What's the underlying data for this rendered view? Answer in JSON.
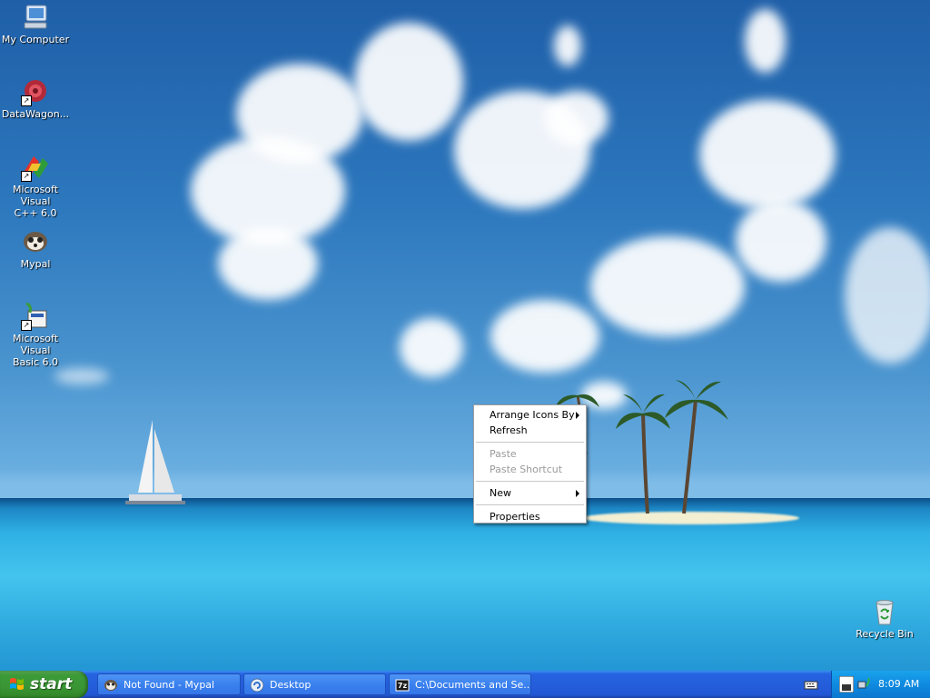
{
  "desktop_icons": [
    {
      "label": "My Computer",
      "icon": "my-computer-icon"
    },
    {
      "label": "DataWagon...",
      "icon": "datawagon-icon"
    },
    {
      "label_line1": "Microsoft Visual",
      "label_line2": "C++ 6.0",
      "icon": "visual-cpp-icon"
    },
    {
      "label": "Mypal",
      "icon": "mypal-icon"
    },
    {
      "label_line1": "Microsoft Visual",
      "label_line2": "Basic 6.0",
      "icon": "visual-basic-icon"
    },
    {
      "label": "Recycle Bin",
      "icon": "recycle-bin-icon"
    }
  ],
  "context_menu": {
    "arrange_icons_by": "Arrange Icons By",
    "refresh": "Refresh",
    "paste": "Paste",
    "paste_shortcut": "Paste Shortcut",
    "new": "New",
    "properties": "Properties"
  },
  "taskbar": {
    "start_label": "start",
    "tasks": [
      {
        "label": "Not Found - Mypal",
        "icon": "mypal-icon"
      },
      {
        "label": "Desktop",
        "icon": "desktop-icon"
      },
      {
        "label": "C:\\Documents and Se...",
        "icon": "7zip-icon"
      }
    ],
    "clock": "8:09 AM"
  },
  "colors": {
    "taskbar_blue": "#245edb",
    "start_green": "#3a9634",
    "tray_blue": "#0f8ae0"
  }
}
